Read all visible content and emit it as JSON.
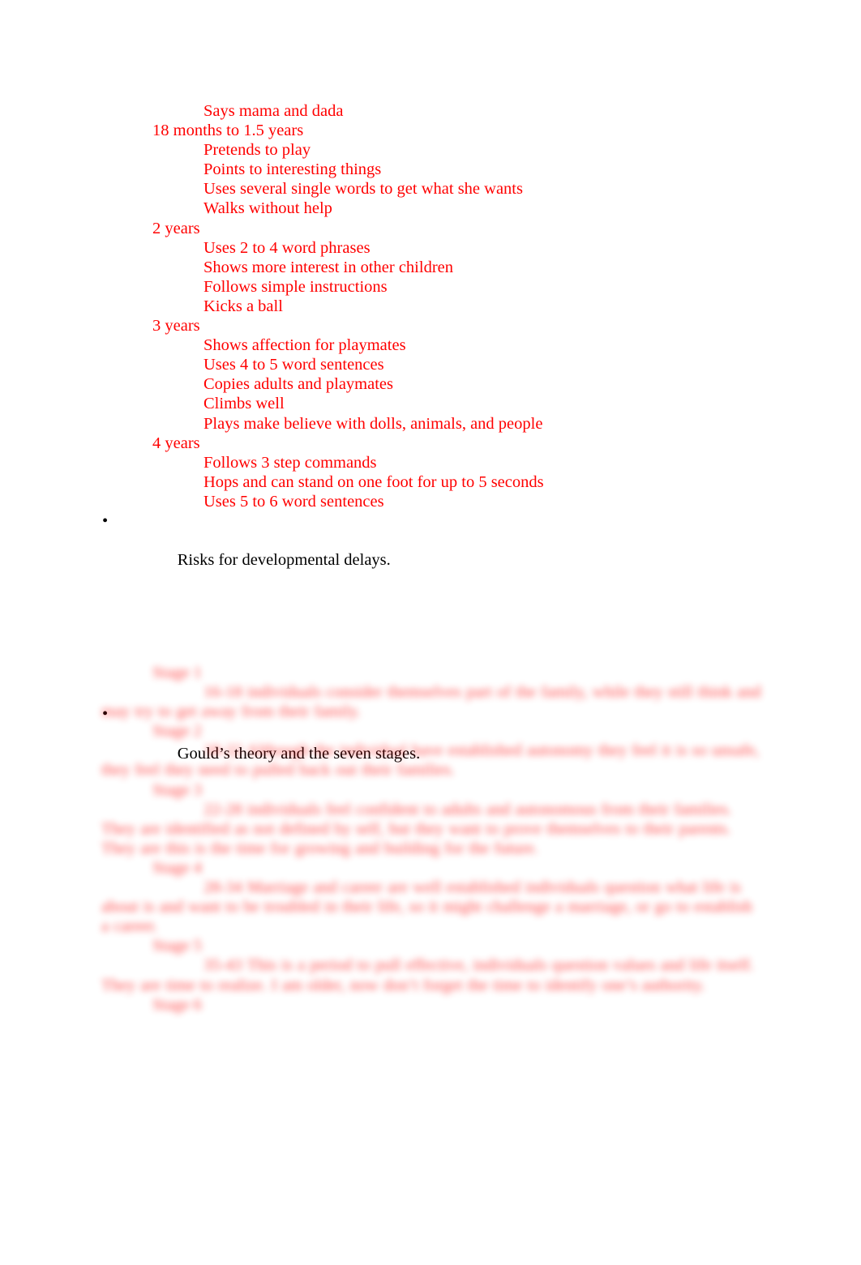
{
  "document": {
    "text_color_primary": "#ff0000",
    "text_color_secondary": "#000000",
    "background_color": "#ffffff"
  },
  "milestones": {
    "intro_line": "Says mama and dada",
    "groups": [
      {
        "age": "18 months to 1.5 years",
        "items": [
          "Pretends to play",
          "Points to interesting things",
          "Uses several single words to get what she wants",
          "Walks without help"
        ]
      },
      {
        "age": "2 years",
        "items": [
          "Uses 2 to 4 word phrases",
          "Shows more interest in other children",
          "Follows simple instructions",
          "Kicks a ball"
        ]
      },
      {
        "age": "3 years",
        "items": [
          "Shows affection for playmates",
          "Uses 4 to 5 word sentences",
          "Copies adults and playmates",
          "Climbs well",
          "Plays make believe with dolls, animals, and people"
        ]
      },
      {
        "age": "4 years",
        "items": [
          "Follows 3 step commands",
          "Hops and can stand on one foot for up to 5 seconds",
          "Uses 5 to 6 word sentences"
        ]
      }
    ]
  },
  "bullets": {
    "marker": "•",
    "risks": "Risks for developmental delays.",
    "gould": "Gould’s theory and the seven stages."
  },
  "stages": {
    "redacted": true,
    "entries": [
      {
        "label": "Stage 1",
        "text": "16-18 individuals consider themselves part of the family, while they still think and may try to get away from their family."
      },
      {
        "label": "Stage 2",
        "text": "18-22 Although the individual have established autonomy they feel it is so unsafe, they feel they need to pulled back out their families."
      },
      {
        "label": "Stage 3",
        "text": "22-28 individuals feel confident to adults and autonomous from their families. They are identified as not defined by self, but they want to prove themselves to their parents. They are this is the time for growing and building for the future."
      },
      {
        "label": "Stage 4",
        "text": "28-34 Marriage and career are well established individuals question what life is about is and want to be troubled in their life, so it might challenge a marriage, or go to establish a career."
      },
      {
        "label": "Stage 5",
        "text": "35-43 This is a period to pull effective, individuals question values and life itself. They are time to realize. I am older, now don’t forget the time to identify one’s authority."
      },
      {
        "label": "Stage 6",
        "text": ""
      }
    ]
  }
}
